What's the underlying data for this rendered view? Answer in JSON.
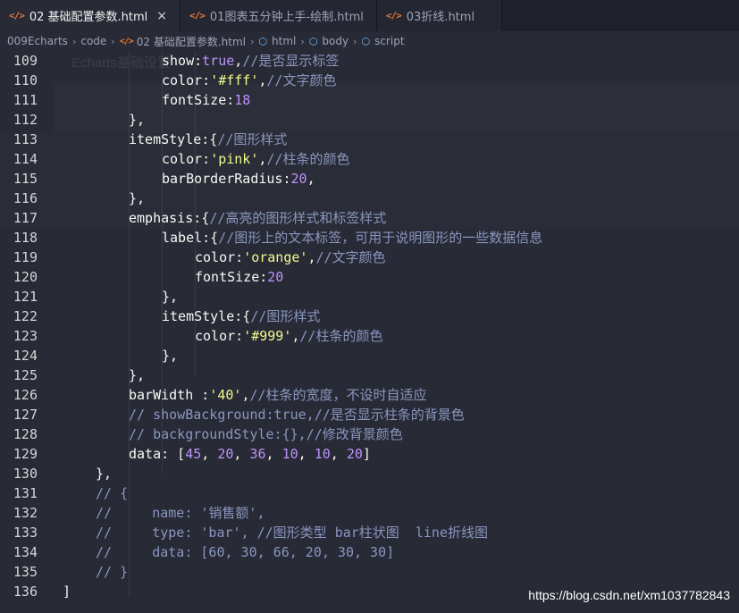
{
  "tabs": [
    {
      "icon": "html-file-icon",
      "label": "02 基础配置参数.html",
      "active": true,
      "close": "×"
    },
    {
      "icon": "html-file-icon",
      "label": "01图表五分钟上手-绘制.html",
      "active": false
    },
    {
      "icon": "html-file-icon",
      "label": "03折线.html",
      "active": false
    }
  ],
  "breadcrumb": {
    "items": [
      "009Echarts",
      "code",
      "02 基础配置参数.html",
      "html",
      "body",
      "script"
    ],
    "separator": "›"
  },
  "ghost": {
    "title": "Echarts基础设置"
  },
  "code": {
    "lines": [
      {
        "n": "109",
        "indent": 5,
        "tokens": [
          [
            "p",
            "show"
          ],
          [
            "u",
            ":"
          ],
          [
            "k",
            "true"
          ],
          [
            "u",
            ","
          ],
          [
            "c",
            "//是否显示标签"
          ]
        ]
      },
      {
        "n": "110",
        "indent": 5,
        "tokens": [
          [
            "p",
            "color"
          ],
          [
            "u",
            ":"
          ],
          [
            "s",
            "'#fff'"
          ],
          [
            "u",
            ","
          ],
          [
            "c",
            "//文字颜色"
          ]
        ]
      },
      {
        "n": "111",
        "indent": 5,
        "tokens": [
          [
            "p",
            "fontSize"
          ],
          [
            "u",
            ":"
          ],
          [
            "n",
            "18"
          ]
        ]
      },
      {
        "n": "112",
        "indent": 4,
        "tokens": [
          [
            "u",
            "},"
          ]
        ]
      },
      {
        "n": "113",
        "indent": 4,
        "tokens": [
          [
            "p",
            "itemStyle"
          ],
          [
            "u",
            ":{"
          ],
          [
            "c",
            "//图形样式"
          ]
        ]
      },
      {
        "n": "114",
        "indent": 5,
        "tokens": [
          [
            "p",
            "color"
          ],
          [
            "u",
            ":"
          ],
          [
            "s",
            "'pink'"
          ],
          [
            "u",
            ","
          ],
          [
            "c",
            "//柱条的颜色"
          ]
        ]
      },
      {
        "n": "115",
        "indent": 5,
        "tokens": [
          [
            "p",
            "barBorderRadius"
          ],
          [
            "u",
            ":"
          ],
          [
            "n",
            "20"
          ],
          [
            "u",
            ","
          ]
        ]
      },
      {
        "n": "116",
        "indent": 4,
        "tokens": [
          [
            "u",
            "},"
          ]
        ]
      },
      {
        "n": "117",
        "indent": 4,
        "tokens": [
          [
            "p",
            "emphasis"
          ],
          [
            "u",
            ":{"
          ],
          [
            "c",
            "//高亮的图形样式和标签样式"
          ]
        ]
      },
      {
        "n": "118",
        "indent": 5,
        "tokens": [
          [
            "p",
            "label"
          ],
          [
            "u",
            ":{"
          ],
          [
            "c",
            "//图形上的文本标签，可用于说明图形的一些数据信息"
          ]
        ]
      },
      {
        "n": "119",
        "indent": 6,
        "tokens": [
          [
            "p",
            "color"
          ],
          [
            "u",
            ":"
          ],
          [
            "s",
            "'orange'"
          ],
          [
            "u",
            ","
          ],
          [
            "c",
            "//文字颜色"
          ]
        ]
      },
      {
        "n": "120",
        "indent": 6,
        "tokens": [
          [
            "p",
            "fontSize"
          ],
          [
            "u",
            ":"
          ],
          [
            "n",
            "20"
          ]
        ]
      },
      {
        "n": "121",
        "indent": 5,
        "tokens": [
          [
            "u",
            "},"
          ]
        ]
      },
      {
        "n": "122",
        "indent": 5,
        "tokens": [
          [
            "p",
            "itemStyle"
          ],
          [
            "u",
            ":{"
          ],
          [
            "c",
            "//图形样式"
          ]
        ]
      },
      {
        "n": "123",
        "indent": 6,
        "tokens": [
          [
            "p",
            "color"
          ],
          [
            "u",
            ":"
          ],
          [
            "s",
            "'#999'"
          ],
          [
            "u",
            ","
          ],
          [
            "c",
            "//柱条的颜色"
          ]
        ]
      },
      {
        "n": "124",
        "indent": 5,
        "tokens": [
          [
            "u",
            "},"
          ]
        ]
      },
      {
        "n": "125",
        "indent": 4,
        "tokens": [
          [
            "u",
            "},"
          ]
        ]
      },
      {
        "n": "126",
        "indent": 4,
        "tokens": [
          [
            "p",
            "barWidth "
          ],
          [
            "u",
            ":"
          ],
          [
            "s",
            "'40'"
          ],
          [
            "u",
            ","
          ],
          [
            "c",
            "//柱条的宽度，不设时自适应"
          ]
        ]
      },
      {
        "n": "127",
        "indent": 4,
        "tokens": [
          [
            "c",
            "// showBackground:true,//是否显示柱条的背景色"
          ]
        ]
      },
      {
        "n": "128",
        "indent": 4,
        "tokens": [
          [
            "c",
            "// backgroundStyle:{},//修改背景颜色"
          ]
        ]
      },
      {
        "n": "129",
        "indent": 4,
        "tokens": [
          [
            "p",
            "data"
          ],
          [
            "u",
            ": ["
          ],
          [
            "n",
            "45"
          ],
          [
            "u",
            ", "
          ],
          [
            "n",
            "20"
          ],
          [
            "u",
            ", "
          ],
          [
            "n",
            "36"
          ],
          [
            "u",
            ", "
          ],
          [
            "n",
            "10"
          ],
          [
            "u",
            ", "
          ],
          [
            "n",
            "10"
          ],
          [
            "u",
            ", "
          ],
          [
            "n",
            "20"
          ],
          [
            "u",
            "]"
          ]
        ]
      },
      {
        "n": "130",
        "indent": 3,
        "tokens": [
          [
            "u",
            "},"
          ]
        ]
      },
      {
        "n": "131",
        "indent": 3,
        "tokens": [
          [
            "c",
            "// {"
          ]
        ]
      },
      {
        "n": "132",
        "indent": 3,
        "tokens": [
          [
            "c",
            "//     name: '销售额',"
          ]
        ]
      },
      {
        "n": "133",
        "indent": 3,
        "tokens": [
          [
            "c",
            "//     type: 'bar', //图形类型 bar柱状图  line折线图"
          ]
        ]
      },
      {
        "n": "134",
        "indent": 3,
        "tokens": [
          [
            "c",
            "//     data: [60, 30, 66, 20, 30, 30]"
          ]
        ]
      },
      {
        "n": "135",
        "indent": 3,
        "tokens": [
          [
            "c",
            "// }"
          ]
        ]
      },
      {
        "n": "136",
        "indent": 2,
        "tokens": [
          [
            "u",
            "]"
          ]
        ]
      }
    ]
  },
  "watermark": "https://blog.csdn.net/xm1037782843",
  "colors": {
    "background": "#282a36",
    "keyword": "#bd93f9",
    "string": "#f1fa8c",
    "comment": "#8b96bf",
    "html_icon": "#e37933",
    "tag_icon": "#75beff"
  }
}
